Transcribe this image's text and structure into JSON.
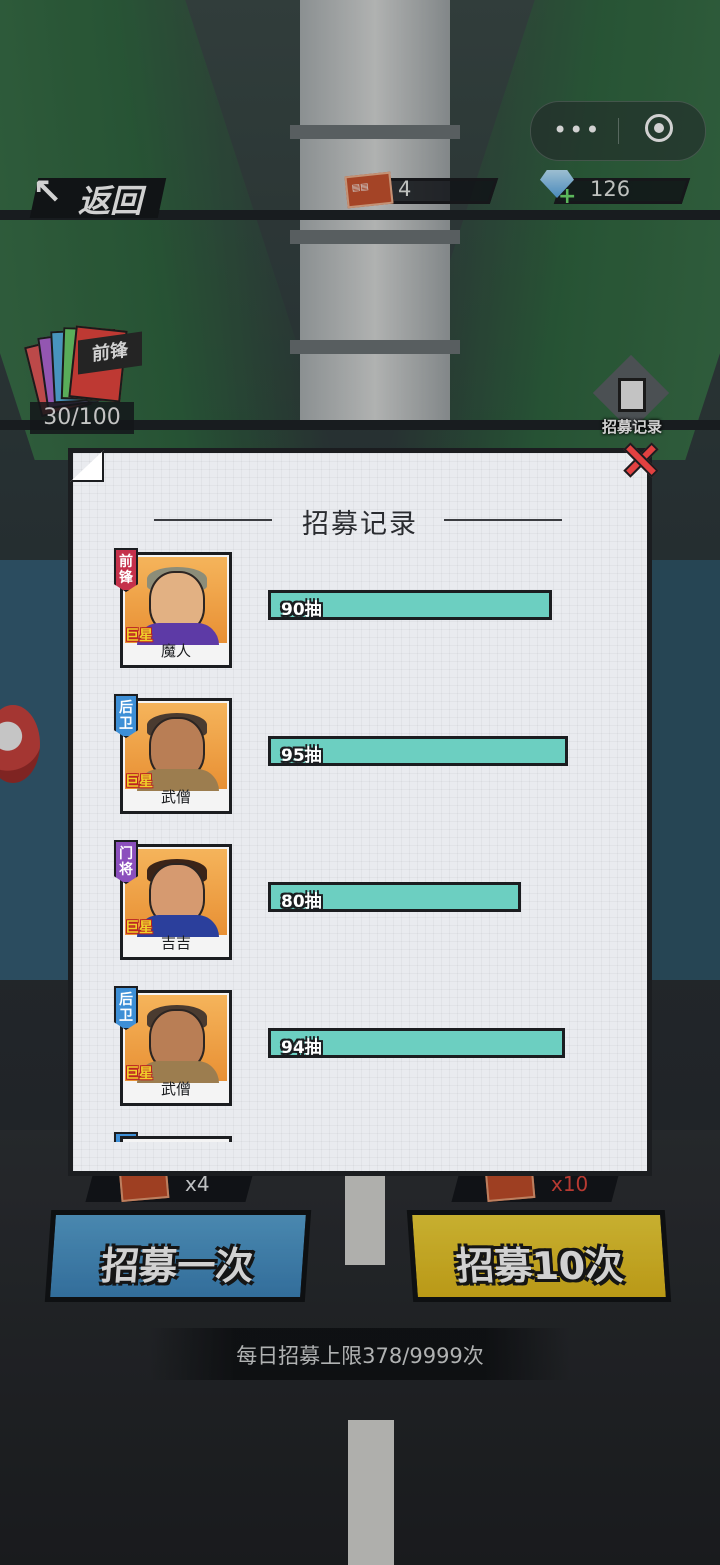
{
  "header": {
    "back_label": "返回",
    "tickets": "4",
    "gems": "126"
  },
  "collection": {
    "card_label": "前锋",
    "progress": "30/100"
  },
  "history_button": {
    "label": "招募记录"
  },
  "modal": {
    "title": "招募记录",
    "records": [
      {
        "position": "前锋",
        "tier": "巨星",
        "name": "魔人",
        "draws": "90抽",
        "draws_value": 90
      },
      {
        "position": "后卫",
        "tier": "巨星",
        "name": "武僧",
        "draws": "95抽",
        "draws_value": 95
      },
      {
        "position": "门将",
        "tier": "巨星",
        "name": "吉吉",
        "draws": "80抽",
        "draws_value": 80
      },
      {
        "position": "后卫",
        "tier": "巨星",
        "name": "武僧",
        "draws": "94抽",
        "draws_value": 94
      }
    ]
  },
  "actions": {
    "single_cost": "x4",
    "ten_cost": "x10",
    "single_label": "招募一次",
    "ten_label": "招募10次",
    "daily_limit": "每日招募上限378/9999次"
  },
  "colors": {
    "bar_fill": "#6ccfc1",
    "forward_badge": "#c5314b",
    "defender_badge": "#3d8fd6",
    "goalkeeper_badge": "#8b4fbd",
    "single_button": "#4a95c9",
    "ten_button": "#ebc82b"
  },
  "icons": [
    "more-dots-icon",
    "target-icon",
    "back-arrow-icon",
    "ticket-icon",
    "gem-icon",
    "record-icon",
    "close-icon"
  ]
}
